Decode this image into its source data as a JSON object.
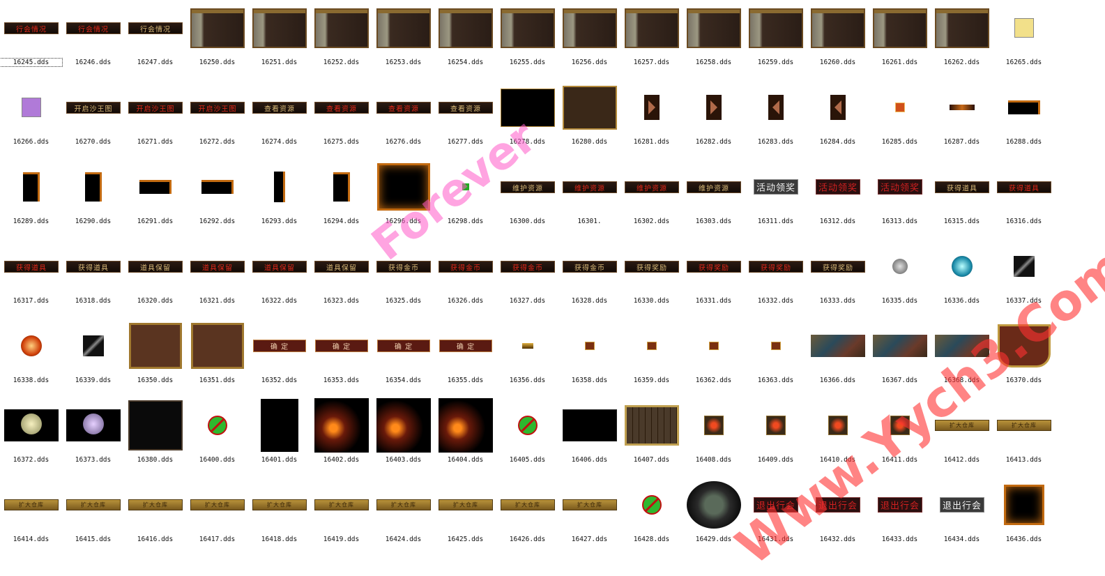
{
  "selected_index": 0,
  "files": [
    {
      "name": "16245.dds",
      "kind": "banner-red",
      "text": "行会情况"
    },
    {
      "name": "16246.dds",
      "kind": "banner-red",
      "text": "行会情况"
    },
    {
      "name": "16247.dds",
      "kind": "banner-gold",
      "text": "行会情况"
    },
    {
      "name": "16250.dds",
      "kind": "panel"
    },
    {
      "name": "16251.dds",
      "kind": "panel"
    },
    {
      "name": "16252.dds",
      "kind": "panel"
    },
    {
      "name": "16253.dds",
      "kind": "panel"
    },
    {
      "name": "16254.dds",
      "kind": "panel"
    },
    {
      "name": "16255.dds",
      "kind": "panel"
    },
    {
      "name": "16256.dds",
      "kind": "panel"
    },
    {
      "name": "16257.dds",
      "kind": "panel"
    },
    {
      "name": "16258.dds",
      "kind": "panel"
    },
    {
      "name": "16259.dds",
      "kind": "panel"
    },
    {
      "name": "16260.dds",
      "kind": "panel"
    },
    {
      "name": "16261.dds",
      "kind": "panel"
    },
    {
      "name": "16262.dds",
      "kind": "panel"
    },
    {
      "name": "16265.dds",
      "kind": "yellow-icon"
    },
    {
      "name": "16266.dds",
      "kind": "purple-icon"
    },
    {
      "name": "16270.dds",
      "kind": "banner-gold",
      "text": "开启沙王图"
    },
    {
      "name": "16271.dds",
      "kind": "banner-red",
      "text": "开启沙王图"
    },
    {
      "name": "16272.dds",
      "kind": "banner-red",
      "text": "开启沙王图"
    },
    {
      "name": "16274.dds",
      "kind": "banner-gold",
      "text": "查看资源"
    },
    {
      "name": "16275.dds",
      "kind": "banner-red",
      "text": "查看资源"
    },
    {
      "name": "16276.dds",
      "kind": "banner-red",
      "text": "查看资源"
    },
    {
      "name": "16277.dds",
      "kind": "banner-gold",
      "text": "查看资源"
    },
    {
      "name": "16278.dds",
      "kind": "blackbox"
    },
    {
      "name": "16280.dds",
      "kind": "gold-frame"
    },
    {
      "name": "16281.dds",
      "kind": "arrow-right"
    },
    {
      "name": "16282.dds",
      "kind": "arrow-right"
    },
    {
      "name": "16283.dds",
      "kind": "arrow-left"
    },
    {
      "name": "16284.dds",
      "kind": "arrow-left"
    },
    {
      "name": "16285.dds",
      "kind": "small-icon"
    },
    {
      "name": "16287.dds",
      "kind": "thin-bar"
    },
    {
      "name": "16288.dds",
      "kind": "orange-corner"
    },
    {
      "name": "16289.dds",
      "kind": "orange-corner-tall"
    },
    {
      "name": "16290.dds",
      "kind": "orange-corner-tall"
    },
    {
      "name": "16291.dds",
      "kind": "orange-corner"
    },
    {
      "name": "16292.dds",
      "kind": "orange-corner"
    },
    {
      "name": "16293.dds",
      "kind": "orange-strip"
    },
    {
      "name": "16294.dds",
      "kind": "orange-corner-tall"
    },
    {
      "name": "16296.dds",
      "kind": "glow-square"
    },
    {
      "name": "16298.dds",
      "kind": "green-dot"
    },
    {
      "name": "16300.dds",
      "kind": "banner-gold",
      "text": "维护资源"
    },
    {
      "name": "16301.",
      "kind": "banner-red",
      "text": "维护资源"
    },
    {
      "name": "16302.dds",
      "kind": "banner-red",
      "text": "维护资源"
    },
    {
      "name": "16303.dds",
      "kind": "banner-gold",
      "text": "维护资源"
    },
    {
      "name": "16311.dds",
      "kind": "greybtn",
      "text": "活动领奖"
    },
    {
      "name": "16312.dds",
      "kind": "redbtn",
      "text": "活动领奖"
    },
    {
      "name": "16313.dds",
      "kind": "redbtn",
      "text": "活动领奖"
    },
    {
      "name": "16315.dds",
      "kind": "banner-gold",
      "text": "获得道具"
    },
    {
      "name": "16316.dds",
      "kind": "banner-red",
      "text": "获得道具"
    },
    {
      "name": "16317.dds",
      "kind": "banner-red",
      "text": "获得道具"
    },
    {
      "name": "16318.dds",
      "kind": "banner-gold",
      "text": "获得道具"
    },
    {
      "name": "16320.dds",
      "kind": "banner-gold",
      "text": "道具保留"
    },
    {
      "name": "16321.dds",
      "kind": "banner-red",
      "text": "道具保留"
    },
    {
      "name": "16322.dds",
      "kind": "banner-red",
      "text": "道具保留"
    },
    {
      "name": "16323.dds",
      "kind": "banner-gold",
      "text": "道具保留"
    },
    {
      "name": "16325.dds",
      "kind": "banner-gold",
      "text": "获得金币"
    },
    {
      "name": "16326.dds",
      "kind": "banner-red",
      "text": "获得金币"
    },
    {
      "name": "16327.dds",
      "kind": "banner-red",
      "text": "获得金币"
    },
    {
      "name": "16328.dds",
      "kind": "banner-gold",
      "text": "获得金币"
    },
    {
      "name": "16330.dds",
      "kind": "banner-gold",
      "text": "获得奖励"
    },
    {
      "name": "16331.dds",
      "kind": "banner-red",
      "text": "获得奖励"
    },
    {
      "name": "16332.dds",
      "kind": "banner-red",
      "text": "获得奖励"
    },
    {
      "name": "16333.dds",
      "kind": "banner-gold",
      "text": "获得奖励"
    },
    {
      "name": "16335.dds",
      "kind": "orb-grey"
    },
    {
      "name": "16336.dds",
      "kind": "orb-blue"
    },
    {
      "name": "16337.dds",
      "kind": "weapon"
    },
    {
      "name": "16338.dds",
      "kind": "orb-red"
    },
    {
      "name": "16339.dds",
      "kind": "weapon"
    },
    {
      "name": "16350.dds",
      "kind": "brown-frame"
    },
    {
      "name": "16351.dds",
      "kind": "brown-frame"
    },
    {
      "name": "16352.dds",
      "kind": "confirm",
      "text": "确 定"
    },
    {
      "name": "16353.dds",
      "kind": "confirm",
      "text": "确 定"
    },
    {
      "name": "16354.dds",
      "kind": "confirm",
      "text": "确 定"
    },
    {
      "name": "16355.dds",
      "kind": "confirm",
      "text": "确 定"
    },
    {
      "name": "16356.dds",
      "kind": "tiny-bar"
    },
    {
      "name": "16358.dds",
      "kind": "tiny-btn"
    },
    {
      "name": "16359.dds",
      "kind": "tiny-btn"
    },
    {
      "name": "16362.dds",
      "kind": "tiny-btn"
    },
    {
      "name": "16363.dds",
      "kind": "tiny-btn"
    },
    {
      "name": "16366.dds",
      "kind": "scene"
    },
    {
      "name": "16367.dds",
      "kind": "scene"
    },
    {
      "name": "16368.dds",
      "kind": "scene"
    },
    {
      "name": "16370.dds",
      "kind": "flag"
    },
    {
      "name": "16372.dds",
      "kind": "flower-gold"
    },
    {
      "name": "16373.dds",
      "kind": "flower-purple"
    },
    {
      "name": "16380.dds",
      "kind": "dark-frame"
    },
    {
      "name": "16400.dds",
      "kind": "green-circle"
    },
    {
      "name": "16401.dds",
      "kind": "black-tall"
    },
    {
      "name": "16402.dds",
      "kind": "fire"
    },
    {
      "name": "16403.dds",
      "kind": "fire"
    },
    {
      "name": "16404.dds",
      "kind": "fire"
    },
    {
      "name": "16405.dds",
      "kind": "green-circle"
    },
    {
      "name": "16406.dds",
      "kind": "sparkle"
    },
    {
      "name": "16407.dds",
      "kind": "grid-panel"
    },
    {
      "name": "16408.dds",
      "kind": "gem-icon"
    },
    {
      "name": "16409.dds",
      "kind": "gem-icon"
    },
    {
      "name": "16410.dds",
      "kind": "gem-icon"
    },
    {
      "name": "16411.dds",
      "kind": "gem-icon"
    },
    {
      "name": "16412.dds",
      "kind": "goldbar",
      "text": "扩大仓库"
    },
    {
      "name": "16413.dds",
      "kind": "goldbar",
      "text": "扩大仓库"
    },
    {
      "name": "16414.dds",
      "kind": "goldbar",
      "text": "扩大仓库"
    },
    {
      "name": "16415.dds",
      "kind": "goldbar",
      "text": "扩大仓库"
    },
    {
      "name": "16416.dds",
      "kind": "goldbar",
      "text": "扩大仓库"
    },
    {
      "name": "16417.dds",
      "kind": "goldbar",
      "text": "扩大仓库"
    },
    {
      "name": "16418.dds",
      "kind": "goldbar",
      "text": "扩大仓库"
    },
    {
      "name": "16419.dds",
      "kind": "goldbar",
      "text": "扩大仓库"
    },
    {
      "name": "16424.dds",
      "kind": "goldbar",
      "text": "扩大仓库"
    },
    {
      "name": "16425.dds",
      "kind": "goldbar",
      "text": "扩大仓库"
    },
    {
      "name": "16426.dds",
      "kind": "goldbar",
      "text": "扩大仓库"
    },
    {
      "name": "16427.dds",
      "kind": "goldbar",
      "text": "扩大仓库"
    },
    {
      "name": "16428.dds",
      "kind": "green-circle"
    },
    {
      "name": "16429.dds",
      "kind": "compass"
    },
    {
      "name": "16431.dds",
      "kind": "redbtn",
      "text": "退出行会"
    },
    {
      "name": "16432.dds",
      "kind": "redbtn",
      "text": "退出行会"
    },
    {
      "name": "16433.dds",
      "kind": "redbtn",
      "text": "退出行会"
    },
    {
      "name": "16434.dds",
      "kind": "greybtn",
      "text": "退出行会"
    },
    {
      "name": "16436.dds",
      "kind": "glow-square"
    }
  ],
  "watermarks": [
    {
      "text": "Forever",
      "color": "#ff66cc"
    },
    {
      "text": "Www.Yych3.Com",
      "color": "#ff3a3a"
    }
  ]
}
